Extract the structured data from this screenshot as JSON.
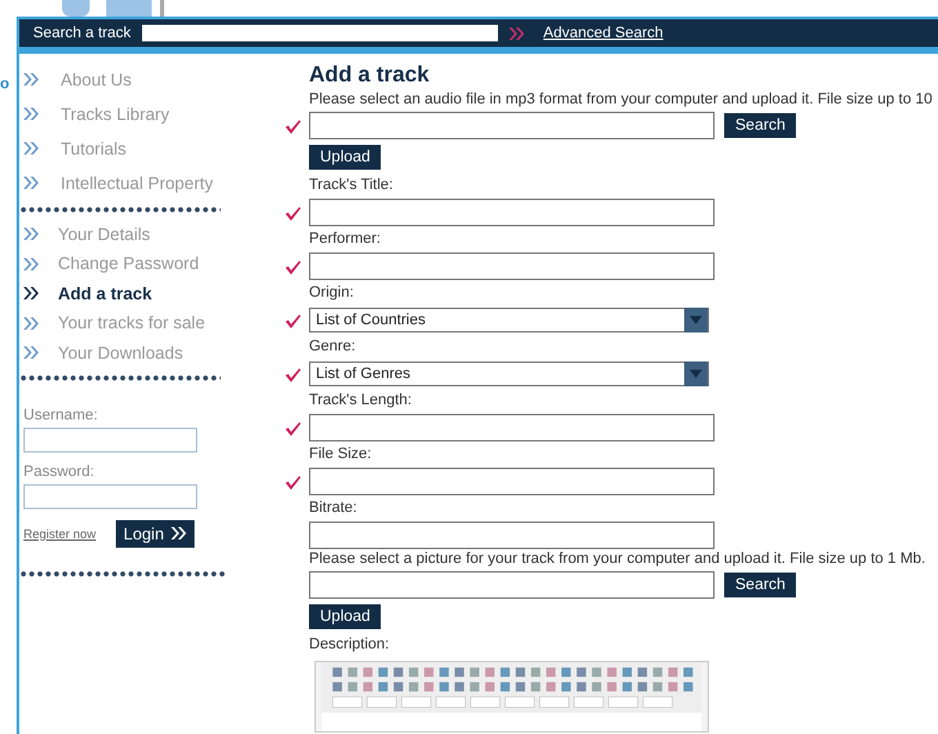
{
  "background": {
    "fragment": "o"
  },
  "header": {
    "search_label": "Search a track",
    "advanced_link": "Advanced Search"
  },
  "menus": [
    {
      "items": [
        {
          "label": "About Us",
          "selected": false
        },
        {
          "label": "Tracks Library",
          "selected": false
        },
        {
          "label": "Tutorials",
          "selected": false
        },
        {
          "label": "Intellectual Property",
          "selected": false
        }
      ]
    },
    {
      "items": [
        {
          "label": "Your Details",
          "selected": false
        },
        {
          "label": "Change Password",
          "selected": false
        },
        {
          "label": "Add a track",
          "selected": true
        },
        {
          "label": "Your tracks for sale",
          "selected": false
        },
        {
          "label": "Your Downloads",
          "selected": false
        }
      ]
    }
  ],
  "login": {
    "username_label": "Username:",
    "password_label": "Password:",
    "register_link": "Register now",
    "login_button": "Login"
  },
  "form": {
    "title": "Add a track",
    "sections": [
      {
        "kind": "upload",
        "intro": "Please select an audio file in mp3 format from your computer and upload it. File size up to 10",
        "required": true,
        "search_button": "Search",
        "upload_button": "Upload"
      },
      {
        "kind": "text",
        "label": "Track's Title:",
        "required": true
      },
      {
        "kind": "text",
        "label": "Performer:",
        "required": true
      },
      {
        "kind": "select",
        "label": "Origin:",
        "required": true,
        "value": "List of Countries"
      },
      {
        "kind": "select",
        "label": "Genre:",
        "required": true,
        "value": "List of Genres"
      },
      {
        "kind": "text",
        "label": "Track's Length:",
        "required": true
      },
      {
        "kind": "text",
        "label": "File Size:",
        "required": true
      },
      {
        "kind": "text",
        "label": "Bitrate:",
        "required": false
      },
      {
        "kind": "upload",
        "intro": "Please select a picture for your track from your computer and upload it. File size up to 1 Mb.",
        "required": false,
        "search_button": "Search",
        "upload_button": "Upload"
      },
      {
        "kind": "editor",
        "label": "Description:"
      }
    ]
  }
}
